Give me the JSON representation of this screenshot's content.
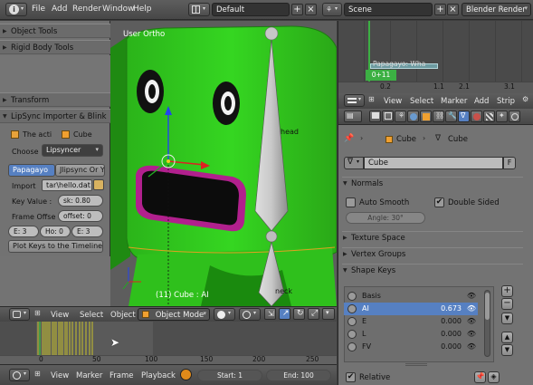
{
  "topbar": {
    "menu": [
      "File",
      "Add",
      "Render",
      "Window",
      "Help"
    ],
    "screen_layout": "Default",
    "scene": "Scene",
    "render_engine": "Blender Render"
  },
  "toolshelf": {
    "sections": {
      "object_tools": "Object Tools",
      "rigid_body_tools": "Rigid Body Tools",
      "transform": "Transform",
      "lipsync": "LipSync Importer & Blink"
    },
    "the_acti": "The acti",
    "cube": "Cube",
    "choose_label": "Choose",
    "choose_value": "Lipsyncer",
    "tab_papagayo": "Papagayo",
    "tab_jlipsync": "Jlipsync Or Yol",
    "import_label": "Import",
    "import_value": "tar\\hello.dat",
    "key_value_label": "Key Value :",
    "key_value": "sk: 0.80",
    "frame_offset_label": "Frame Offse",
    "frame_offset": "offset: 0",
    "e3a": "E: 3",
    "ho": "Ho: 0",
    "e3b": "E: 3",
    "plot_button": "Plot Keys to the Timeline"
  },
  "viewport": {
    "view_label": "User Ortho",
    "bone_head": "head",
    "bone_neck": "neck",
    "status": "(11) Cube : AI"
  },
  "view_header": {
    "view": "View",
    "select": "Select",
    "object": "Object",
    "mode": "Object Mode"
  },
  "timeline": {
    "ticks": [
      "0",
      "50",
      "100",
      "150",
      "200",
      "250"
    ]
  },
  "timeline_footer": {
    "view": "View",
    "marker": "Marker",
    "frame": "Frame",
    "playback": "Playback",
    "start": "Start: 1",
    "end": "End: 100"
  },
  "graph": {
    "channel": "Papagayo: Wha",
    "current_frame": "0+11",
    "ticks": [
      "0.2",
      "1.1",
      "2.1",
      "3.1"
    ]
  },
  "graph_header": {
    "view": "View",
    "select": "Select",
    "marker": "Marker",
    "add": "Add",
    "strip": "Strip"
  },
  "properties": {
    "breadcrumb_object": "Cube",
    "breadcrumb_data": "Cube",
    "mesh_name": "Cube",
    "fake_user": "F",
    "normals": "Normals",
    "auto_smooth": "Auto Smooth",
    "double_sided": "Double Sided",
    "angle": "Angle: 30°",
    "texture_space": "Texture Space",
    "vertex_groups": "Vertex Groups",
    "shape_keys": "Shape Keys",
    "keys": [
      {
        "name": "Basis",
        "value": ""
      },
      {
        "name": "AI",
        "value": "0.673"
      },
      {
        "name": "E",
        "value": "0.000"
      },
      {
        "name": "L",
        "value": "0.000"
      },
      {
        "name": "FV",
        "value": "0.000"
      }
    ],
    "relative": "Relative"
  },
  "colors": {
    "accent": "#5680c2",
    "character_green": "#2fd41a",
    "mouth_rim": "#b1208d"
  }
}
